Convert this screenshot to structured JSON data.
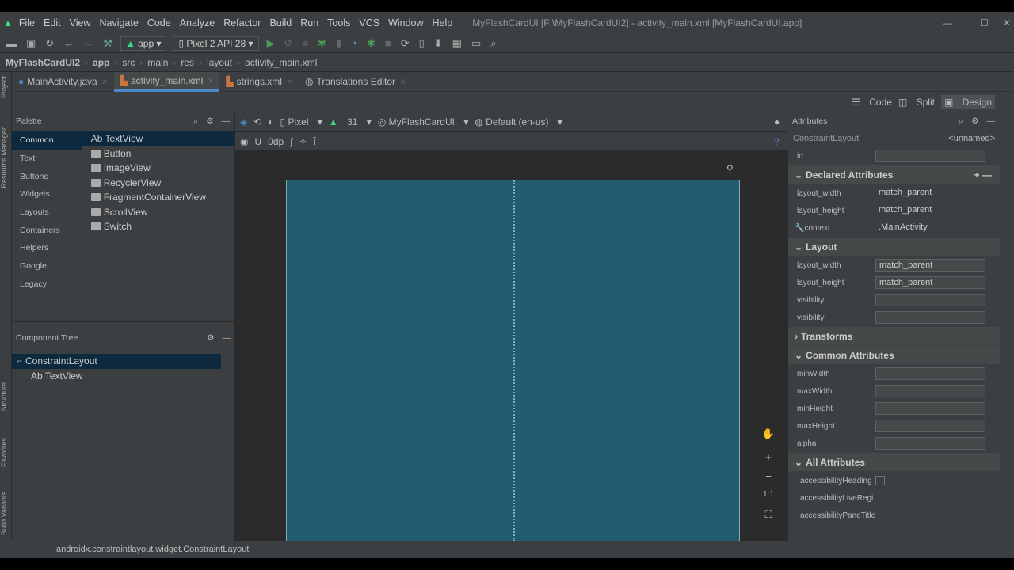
{
  "menu": [
    "File",
    "Edit",
    "View",
    "Navigate",
    "Code",
    "Analyze",
    "Refactor",
    "Build",
    "Run",
    "Tools",
    "VCS",
    "Window",
    "Help"
  ],
  "window_title": "MyFlashCardUI [F:\\MyFlashCardUI2] - activity_main.xml [MyFlashCardUI.app]",
  "toolbar": {
    "run_config": "app",
    "device": "Pixel 2 API 28"
  },
  "breadcrumb": [
    "MyFlashCardUI2",
    "app",
    "src",
    "main",
    "res",
    "layout",
    "activity_main.xml"
  ],
  "tabs": [
    "MainActivity.java",
    "activity_main.xml",
    "strings.xml",
    "Translations Editor"
  ],
  "modes": [
    "Code",
    "Split",
    "Design"
  ],
  "side_tabs": [
    "Project",
    "Resource Manager",
    "Structure",
    "Favorites",
    "Build Variants"
  ],
  "palette": {
    "title": "Palette",
    "categories": [
      "Common",
      "Text",
      "Buttons",
      "Widgets",
      "Layouts",
      "Containers",
      "Helpers",
      "Google",
      "Legacy"
    ],
    "items": [
      "Ab TextView",
      "Button",
      "ImageView",
      "RecyclerView",
      "FragmentContainerView",
      "ScrollView",
      "Switch"
    ]
  },
  "component_tree": {
    "title": "Component Tree",
    "root": "ConstraintLayout",
    "child": "Ab TextView"
  },
  "design_toolbar": {
    "device": "Pixel",
    "api": "31",
    "theme": "MyFlashCardUI",
    "locale": "Default (en-us)",
    "margin": "0dp"
  },
  "zoom_controls": {
    "one_to_one": "1:1"
  },
  "attributes": {
    "title": "Attributes",
    "component": "ConstraintLayout",
    "name": "<unnamed>",
    "id_label": "id",
    "declared_title": "Declared Attributes",
    "declared": [
      {
        "k": "layout_width",
        "v": "match_parent"
      },
      {
        "k": "layout_height",
        "v": "match_parent"
      },
      {
        "k": "context",
        "v": ".MainActivity"
      }
    ],
    "layout_title": "Layout",
    "layout": [
      {
        "k": "layout_width",
        "v": "match_parent"
      },
      {
        "k": "layout_height",
        "v": "match_parent"
      },
      {
        "k": "visibility",
        "v": ""
      },
      {
        "k": "visibility",
        "v": ""
      }
    ],
    "transforms_title": "Transforms",
    "common_title": "Common Attributes",
    "common": [
      "minWidth",
      "maxWidth",
      "minHeight",
      "maxHeight",
      "alpha"
    ],
    "all_title": "All Attributes",
    "all": [
      "accessibilityHeading",
      "accessibilityLiveRegi...",
      "accessibilityPaneTitle"
    ]
  },
  "status": "androidx.constraintlayout.widget.ConstraintLayout",
  "colors": {
    "canvas": "#215c70",
    "accent": "#4a88c7"
  }
}
